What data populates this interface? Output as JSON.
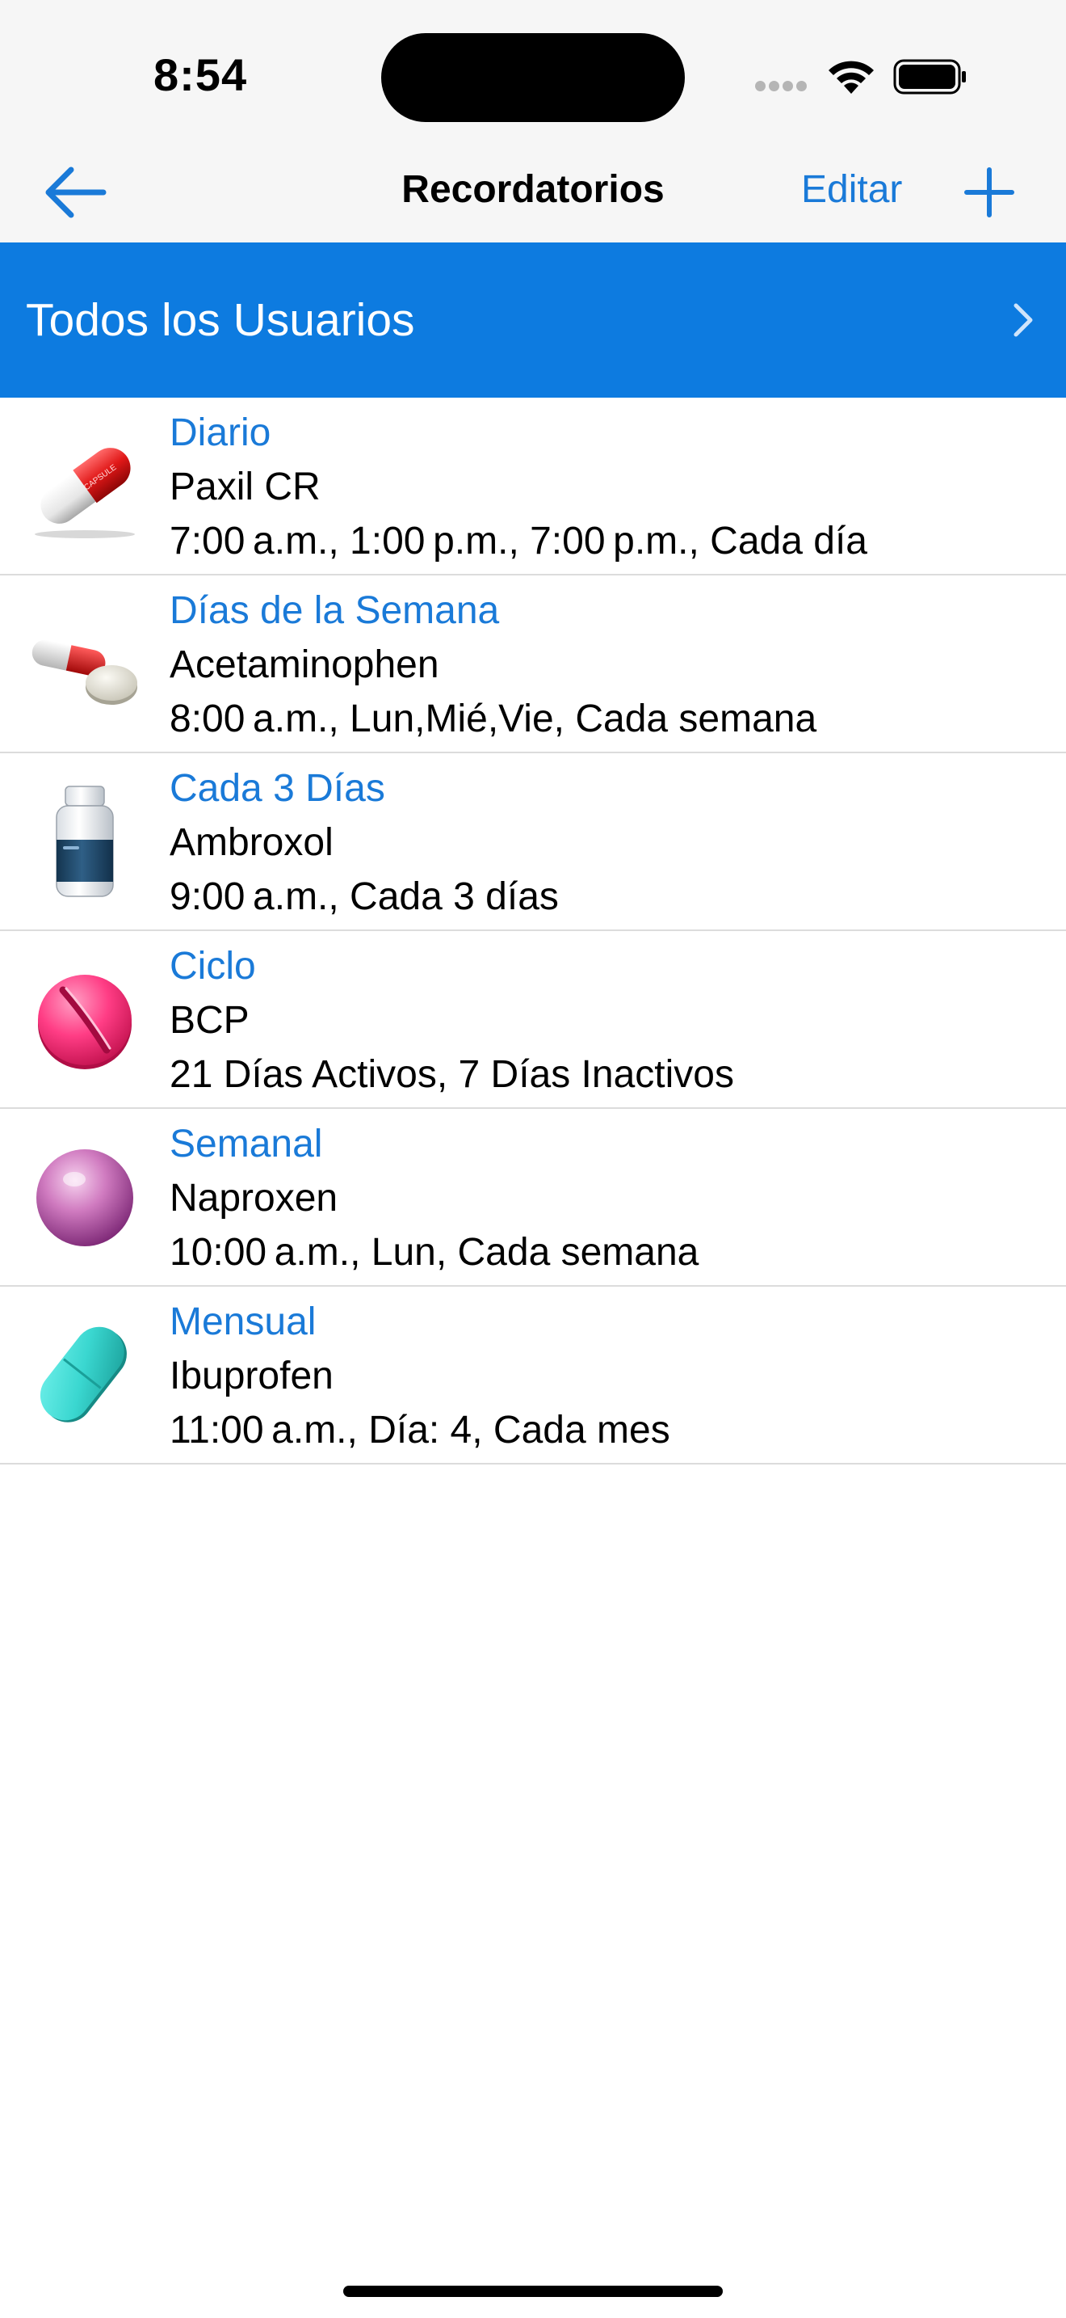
{
  "status_bar": {
    "time": "8:54"
  },
  "nav": {
    "title": "Recordatorios",
    "edit_label": "Editar",
    "accent_color": "#1a7ad8"
  },
  "users_bar": {
    "label": "Todos los Usuarios",
    "background_color": "#0d7be0"
  },
  "reminders": [
    {
      "title": "Diario",
      "name": "Paxil CR",
      "detail": "7:00 a.m., 1:00 p.m., 7:00 p.m., Cada día",
      "icon": "red-white-capsule-icon",
      "capsule_text": "CAPSULE"
    },
    {
      "title": "Días de la Semana",
      "name": "Acetaminophen",
      "detail": "8:00 a.m., Lun,Mié,Vie, Cada semana",
      "icon": "capsule-and-tablet-icon"
    },
    {
      "title": "Cada 3 Días",
      "name": "Ambroxol",
      "detail": "9:00 a.m., Cada 3 días",
      "icon": "medicine-bottle-icon"
    },
    {
      "title": "Ciclo",
      "name": "BCP",
      "detail": "21 Días Activos, 7 Días Inactivos",
      "icon": "pink-scored-tablet-icon"
    },
    {
      "title": "Semanal",
      "name": "Naproxen",
      "detail": "10:00 a.m., Lun, Cada semana",
      "icon": "purple-sphere-pill-icon"
    },
    {
      "title": "Mensual",
      "name": "Ibuprofen",
      "detail": "11:00 a.m., Día: 4, Cada mes",
      "icon": "teal-oval-tablet-icon"
    }
  ]
}
